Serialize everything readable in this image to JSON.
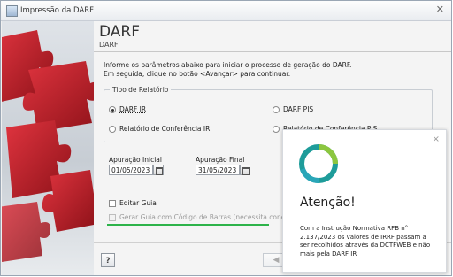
{
  "window": {
    "title": "Impressão da DARF",
    "close_label": "✕",
    "icon": "app-icon"
  },
  "header": {
    "title": "DARF",
    "subtitle": "DARF"
  },
  "intro": {
    "line1": "Informe os parâmetros abaixo para iniciar o processo de geração do DARF.",
    "line2": "Em seguida, clique no botão <Avançar> para continuar."
  },
  "report_type": {
    "legend": "Tipo de Relatório",
    "options": [
      {
        "label": "DARF IR",
        "checked": true
      },
      {
        "label": "DARF PIS",
        "checked": false
      },
      {
        "label": "Relatório de Conferência IR",
        "checked": false
      },
      {
        "label": "Relatório de Conferência PIS",
        "checked": false
      }
    ]
  },
  "apuracao": {
    "inicial_label": "Apuração Inicial",
    "inicial_value": "01/05/2023",
    "final_label": "Apuração Final",
    "final_value": "31/05/2023"
  },
  "options": {
    "editar_guia": "Editar Guia",
    "gerar_guia": "Gerar Guia com Código de Barras (necessita conexão co"
  },
  "footer": {
    "help_label": "?",
    "back_label": "◀"
  },
  "notification": {
    "close_label": "×",
    "title": "Atenção!",
    "body": "Com a Instrução Normativa RFB n° 2.137/2023 os valores de IRRF passam a ser recolhidos através da DCTFWEB e não mais pela DARF IR",
    "accent": "#2db34a"
  },
  "colors": {
    "accent_red": "#c8202c",
    "highlight_green": "#2db34a"
  }
}
